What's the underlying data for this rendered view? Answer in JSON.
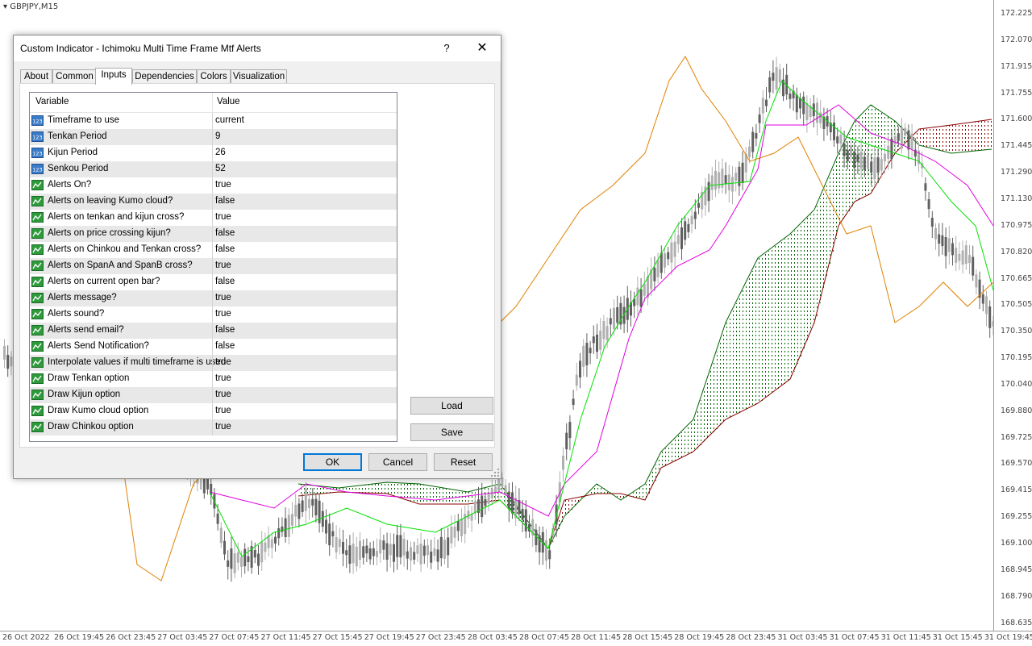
{
  "chart": {
    "symbol": "GBPJPY,M15",
    "price_ticks": [
      "172.225",
      "172.070",
      "171.915",
      "171.755",
      "171.600",
      "171.445",
      "171.290",
      "171.130",
      "170.975",
      "170.820",
      "170.665",
      "170.505",
      "170.350",
      "170.195",
      "170.040",
      "169.880",
      "169.725",
      "169.570",
      "169.415",
      "169.255",
      "169.100",
      "168.945",
      "168.790",
      "168.635"
    ],
    "time_ticks": [
      "26 Oct 2022",
      "26 Oct 19:45",
      "26 Oct 23:45",
      "27 Oct 03:45",
      "27 Oct 07:45",
      "27 Oct 11:45",
      "27 Oct 15:45",
      "27 Oct 19:45",
      "27 Oct 23:45",
      "28 Oct 03:45",
      "28 Oct 07:45",
      "28 Oct 11:45",
      "28 Oct 15:45",
      "28 Oct 19:45",
      "28 Oct 23:45",
      "31 Oct 03:45",
      "31 Oct 07:45",
      "31 Oct 11:45",
      "31 Oct 15:45",
      "31 Oct 19:45"
    ],
    "colors": {
      "tenkan": "#00e000",
      "kijun": "#e000e0",
      "chinkou": "#e08000",
      "cloud_up": "#006400",
      "cloud_down": "#8b0000",
      "candle_up": "#b0b0b0",
      "candle_down": "#606060"
    }
  },
  "dialog": {
    "title": "Custom Indicator - Ichimoku Multi Time Frame Mtf Alerts",
    "help": "?",
    "close": "✕",
    "tabs": [
      "About",
      "Common",
      "Inputs",
      "Dependencies",
      "Colors",
      "Visualization"
    ],
    "active_tab": "Inputs",
    "columns": {
      "variable": "Variable",
      "value": "Value"
    },
    "inputs": [
      {
        "icon": "number-icon",
        "name": "Timeframe to use",
        "value": "current"
      },
      {
        "icon": "number-icon",
        "name": "Tenkan Period",
        "value": "9"
      },
      {
        "icon": "number-icon",
        "name": "Kijun Period",
        "value": "26"
      },
      {
        "icon": "number-icon",
        "name": "Senkou Period",
        "value": "52"
      },
      {
        "icon": "boolean-icon",
        "name": "Alerts On?",
        "value": "true"
      },
      {
        "icon": "boolean-icon",
        "name": "Alerts on leaving Kumo cloud?",
        "value": "false"
      },
      {
        "icon": "boolean-icon",
        "name": "Alerts on tenkan and kijun cross?",
        "value": "true"
      },
      {
        "icon": "boolean-icon",
        "name": "Alerts on price crossing kijun?",
        "value": "false"
      },
      {
        "icon": "boolean-icon",
        "name": "Alerts on Chinkou and Tenkan cross?",
        "value": "false"
      },
      {
        "icon": "boolean-icon",
        "name": "Alerts on SpanA and SpanB cross?",
        "value": "true"
      },
      {
        "icon": "boolean-icon",
        "name": "Alerts on current open bar?",
        "value": "false"
      },
      {
        "icon": "boolean-icon",
        "name": "Alerts message?",
        "value": "true"
      },
      {
        "icon": "boolean-icon",
        "name": "Alerts sound?",
        "value": "true"
      },
      {
        "icon": "boolean-icon",
        "name": "Alerts send email?",
        "value": "false"
      },
      {
        "icon": "boolean-icon",
        "name": "Alerts Send Notification?",
        "value": "false"
      },
      {
        "icon": "boolean-icon",
        "name": "Interpolate values if multi timeframe is used",
        "value": "true"
      },
      {
        "icon": "boolean-icon",
        "name": "Draw Tenkan option",
        "value": "true"
      },
      {
        "icon": "boolean-icon",
        "name": "Draw Kijun option",
        "value": "true"
      },
      {
        "icon": "boolean-icon",
        "name": "Draw Kumo cloud option",
        "value": "true"
      },
      {
        "icon": "boolean-icon",
        "name": "Draw Chinkou option",
        "value": "true"
      }
    ],
    "buttons": {
      "load": "Load",
      "save": "Save",
      "ok": "OK",
      "cancel": "Cancel",
      "reset": "Reset"
    }
  }
}
